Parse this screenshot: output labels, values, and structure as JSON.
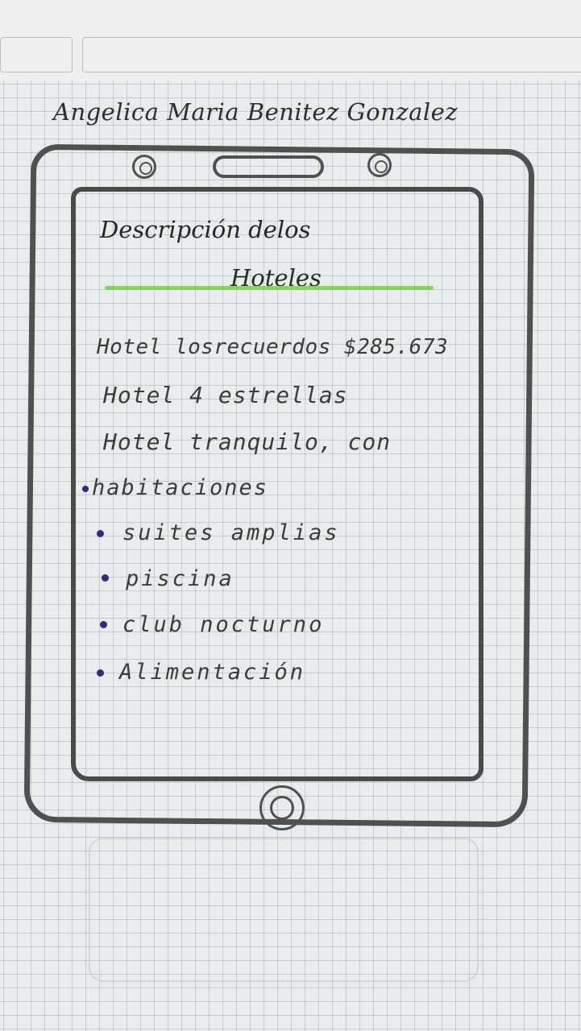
{
  "author": "Angelica Maria Benitez Gonzalez",
  "screen": {
    "title_line1": "Descripción delos",
    "title_line2": "Hoteles",
    "lines": [
      "Hotel losrecuerdos $285.673",
      "Hotel 4 estrellas",
      "Hotel tranquilo, con"
    ],
    "bullets": [
      "habitaciones",
      "suites amplias",
      "piscina",
      "club nocturno",
      "Alimentación"
    ]
  },
  "colors": {
    "underline": "#79d64a",
    "bullet": "#34287e",
    "ink": "#3b3b3b"
  },
  "icons": [
    "camera-icon",
    "speaker-icon",
    "home-button-icon"
  ]
}
